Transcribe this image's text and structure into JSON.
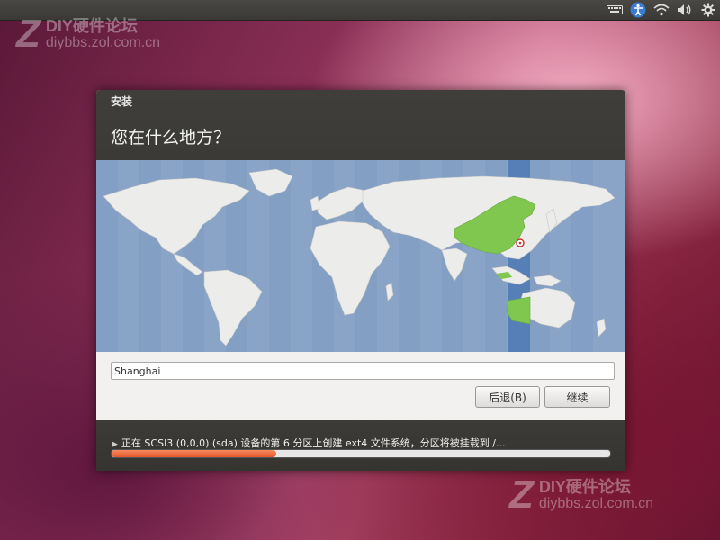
{
  "topbar": {
    "icons": [
      "keyboard-icon",
      "accessibility-icon",
      "wifi-icon",
      "volume-icon",
      "gear-icon"
    ]
  },
  "watermark": {
    "logo": "Z",
    "line1": "DIY硬件论坛",
    "line2": "diybbs.zol.com.cn"
  },
  "window": {
    "title": "安装",
    "heading": "您在什么地方？"
  },
  "location": {
    "value": "Shanghai",
    "highlighted_timezone": "China"
  },
  "buttons": {
    "back_label": "后退(B)",
    "next_label": "继续"
  },
  "status": {
    "text": "正在 SCSI3 (0,0,0) (sda) 设备的第 6 分区上创建 ext4 文件系统，分区将被挂载到 /...",
    "progress": 0.33
  },
  "colors": {
    "accent": "#e4572e",
    "map_ocean": "#8aa4c8",
    "map_land": "#ececea",
    "map_highlight": "#7fc74e",
    "timezone_band": "#4b79b3"
  }
}
